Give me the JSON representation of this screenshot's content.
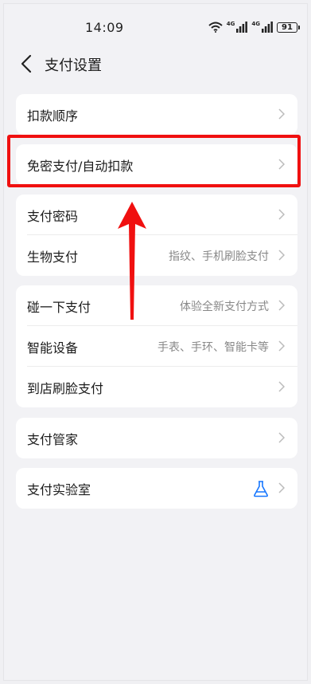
{
  "status_bar": {
    "time": "14:09",
    "signal1_label": "4G",
    "signal2_label": "4G",
    "battery": "91"
  },
  "header": {
    "title": "支付设置"
  },
  "groups": [
    {
      "rows": [
        {
          "label": "扣款顺序",
          "value": ""
        }
      ]
    },
    {
      "rows": [
        {
          "label": "免密支付/自动扣款",
          "value": ""
        }
      ]
    },
    {
      "rows": [
        {
          "label": "支付密码",
          "value": ""
        },
        {
          "label": "生物支付",
          "value": "指纹、手机刷脸支付"
        }
      ]
    },
    {
      "rows": [
        {
          "label": "碰一下支付",
          "value": "体验全新支付方式"
        },
        {
          "label": "智能设备",
          "value": "手表、手环、智能卡等"
        },
        {
          "label": "到店刷脸支付",
          "value": ""
        }
      ]
    },
    {
      "rows": [
        {
          "label": "支付管家",
          "value": ""
        }
      ]
    },
    {
      "rows": [
        {
          "label": "支付实验室",
          "value": "",
          "icon": "flask-icon"
        }
      ]
    }
  ],
  "annotation": {
    "highlight_color": "#f01010",
    "arrow_color": "#f01010"
  },
  "colors": {
    "background": "#f2f2f5",
    "card": "#ffffff",
    "accent_blue": "#1677ff"
  }
}
